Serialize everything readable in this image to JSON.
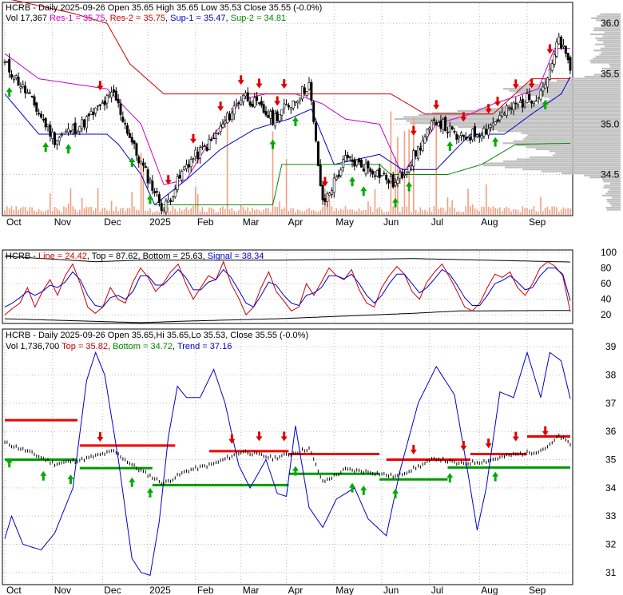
{
  "chart_data": [
    {
      "type": "candlestick",
      "header": {
        "line1": [
          "HCRB - Daily 2025-09-26 Open 35.65  High 35.65  Low 35.53  Close 35.55 (-0.0%)"
        ],
        "line2": [
          {
            "text": "Vol 17,367 ",
            "color": "#000000"
          },
          {
            "text": "Res-1 = 35.75",
            "color": "#cc00cc"
          },
          {
            "text": ", ",
            "color": "#000000"
          },
          {
            "text": "Res-2 = 35.75",
            "color": "#cc0000"
          },
          {
            "text": ", ",
            "color": "#000000"
          },
          {
            "text": "Sup-1 = 35.47",
            "color": "#0000cc"
          },
          {
            "text": ", ",
            "color": "#000000"
          },
          {
            "text": "Sup-2 = 34.81",
            "color": "#008800"
          }
        ]
      },
      "ylim": [
        34.1,
        36.2
      ],
      "yticks": [
        "36.0",
        "35.5",
        "35.0",
        "34.5"
      ],
      "months": [
        "Oct",
        "Nov",
        "Dec",
        "2025",
        "Feb",
        "Mar",
        "Apr",
        "May",
        "Jun",
        "Jul",
        "Aug",
        "Sep"
      ],
      "close_key": [
        [
          0,
          35.6
        ],
        [
          10,
          35.3
        ],
        [
          22,
          34.85
        ],
        [
          34,
          35.0
        ],
        [
          48,
          35.3
        ],
        [
          58,
          34.7
        ],
        [
          70,
          34.15
        ],
        [
          80,
          34.6
        ],
        [
          92,
          34.85
        ],
        [
          105,
          35.3
        ],
        [
          118,
          35.05
        ],
        [
          128,
          35.25
        ],
        [
          134,
          35.4
        ],
        [
          140,
          34.2
        ],
        [
          150,
          34.65
        ],
        [
          162,
          34.55
        ],
        [
          172,
          34.4
        ],
        [
          182,
          34.75
        ],
        [
          190,
          35.05
        ],
        [
          200,
          34.85
        ],
        [
          212,
          34.95
        ],
        [
          222,
          35.15
        ],
        [
          235,
          35.3
        ],
        [
          240,
          35.5
        ],
        [
          244,
          35.85
        ],
        [
          249,
          35.55
        ]
      ],
      "res1_key": [
        [
          0,
          35.7
        ],
        [
          15,
          35.45
        ],
        [
          45,
          35.35
        ],
        [
          60,
          35.0
        ],
        [
          70,
          34.4
        ],
        [
          80,
          34.45
        ],
        [
          92,
          34.9
        ],
        [
          105,
          35.25
        ],
        [
          115,
          35.3
        ],
        [
          128,
          35.3
        ],
        [
          140,
          35.2
        ],
        [
          150,
          35.05
        ],
        [
          165,
          35.0
        ],
        [
          175,
          34.5
        ],
        [
          190,
          35.0
        ],
        [
          205,
          35.1
        ],
        [
          215,
          35.2
        ],
        [
          235,
          35.35
        ],
        [
          242,
          35.75
        ],
        [
          249,
          35.75
        ]
      ],
      "res2_key": [
        [
          0,
          36.25
        ],
        [
          30,
          36.1
        ],
        [
          45,
          36.0
        ],
        [
          55,
          35.6
        ],
        [
          70,
          35.3
        ],
        [
          100,
          35.3
        ],
        [
          170,
          35.3
        ],
        [
          185,
          35.1
        ],
        [
          200,
          35.1
        ],
        [
          215,
          35.1
        ],
        [
          232,
          35.45
        ],
        [
          249,
          35.45
        ]
      ],
      "sup1_key": [
        [
          0,
          35.3
        ],
        [
          15,
          34.9
        ],
        [
          45,
          34.9
        ],
        [
          50,
          34.8
        ],
        [
          60,
          34.5
        ],
        [
          66,
          34.2
        ],
        [
          80,
          34.45
        ],
        [
          95,
          34.75
        ],
        [
          110,
          34.95
        ],
        [
          125,
          35.05
        ],
        [
          135,
          35.15
        ],
        [
          145,
          34.6
        ],
        [
          165,
          34.7
        ],
        [
          175,
          34.55
        ],
        [
          190,
          34.55
        ],
        [
          205,
          34.9
        ],
        [
          220,
          34.9
        ],
        [
          232,
          35.1
        ],
        [
          245,
          35.3
        ],
        [
          249,
          35.47
        ]
      ],
      "sup2_key": [
        [
          66,
          34.2
        ],
        [
          118,
          34.2
        ],
        [
          122,
          34.6
        ],
        [
          165,
          34.6
        ],
        [
          170,
          34.5
        ],
        [
          195,
          34.5
        ],
        [
          210,
          34.6
        ],
        [
          225,
          34.8
        ],
        [
          249,
          34.81
        ]
      ],
      "down_arrows": [
        42,
        72,
        83,
        95,
        104,
        112,
        120,
        123,
        141,
        180,
        190,
        202,
        213,
        217,
        225,
        232,
        240
      ],
      "up_arrows": [
        2,
        18,
        28,
        56,
        64,
        118,
        128,
        153,
        158,
        172,
        178,
        196,
        216,
        238
      ]
    },
    {
      "type": "line",
      "header": [
        {
          "text": "HCRB - ",
          "color": "#000000"
        },
        {
          "text": "Line = 24.42",
          "color": "#cc0000"
        },
        {
          "text": ", Top = 87.62, Bottom = 25.63, ",
          "color": "#000000"
        },
        {
          "text": "Signal = 38.34",
          "color": "#0000cc"
        }
      ],
      "ylim": [
        10,
        102
      ],
      "yticks": [
        "100",
        "80",
        "60",
        "40",
        "20"
      ],
      "months": [
        "Oct",
        "Nov",
        "Dec",
        "2025",
        "Feb",
        "Mar",
        "Apr",
        "May",
        "Jun",
        "Jul",
        "Aug",
        "Sep"
      ],
      "series": [
        {
          "name": "Line",
          "values": [
            20,
            28,
            35,
            55,
            30,
            50,
            65,
            45,
            70,
            85,
            60,
            30,
            22,
            30,
            55,
            40,
            35,
            62,
            80,
            68,
            50,
            60,
            75,
            85,
            60,
            40,
            55,
            70,
            65,
            88,
            60,
            42,
            20,
            30,
            55,
            75,
            50,
            38,
            25,
            30,
            60,
            45,
            62,
            80,
            70,
            65,
            78,
            52,
            35,
            30,
            55,
            70,
            82,
            72,
            50,
            40,
            62,
            75,
            85,
            68,
            50,
            30,
            25,
            35,
            55,
            72,
            68,
            75,
            55,
            45,
            60,
            80,
            88,
            82,
            70,
            24
          ]
        },
        {
          "name": "Signal",
          "values": [
            30,
            35,
            42,
            50,
            45,
            50,
            58,
            55,
            62,
            75,
            65,
            45,
            32,
            30,
            42,
            45,
            40,
            50,
            70,
            70,
            58,
            58,
            68,
            78,
            68,
            52,
            52,
            62,
            65,
            78,
            68,
            52,
            35,
            30,
            45,
            62,
            58,
            45,
            35,
            32,
            45,
            48,
            55,
            70,
            70,
            66,
            72,
            60,
            45,
            35,
            45,
            60,
            72,
            72,
            60,
            48,
            55,
            66,
            78,
            72,
            58,
            42,
            32,
            32,
            45,
            60,
            64,
            70,
            62,
            52,
            55,
            70,
            80,
            80,
            72,
            38
          ]
        }
      ],
      "top_key": [
        [
          0,
          95
        ],
        [
          40,
          88
        ],
        [
          60,
          90
        ],
        [
          120,
          90
        ],
        [
          180,
          92
        ],
        [
          249,
          87.62
        ]
      ],
      "bottom_key": [
        [
          0,
          15
        ],
        [
          60,
          10
        ],
        [
          80,
          12
        ],
        [
          120,
          15
        ],
        [
          180,
          22
        ],
        [
          200,
          25
        ],
        [
          249,
          25.63
        ]
      ]
    },
    {
      "type": "line",
      "header": {
        "line1": [
          "HCRB - Daily 2025-09-26 Open 35.65,Hi 35.65,Lo 35.53, Close 35.55 (-0.0%)"
        ],
        "line2": [
          {
            "text": "Vol 1,736,700 ",
            "color": "#000000"
          },
          {
            "text": "Top = 35.82",
            "color": "#cc0000"
          },
          {
            "text": ", ",
            "color": "#000000"
          },
          {
            "text": "Bottom = 34.72",
            "color": "#008800"
          },
          {
            "text": ", ",
            "color": "#000000"
          },
          {
            "text": "Trend = 37.16",
            "color": "#0000cc"
          }
        ]
      },
      "ylim": [
        30.6,
        39.6
      ],
      "yticks": [
        "39",
        "38",
        "37",
        "36",
        "35",
        "34",
        "33",
        "32",
        "31"
      ],
      "months": [
        "Oct",
        "Nov",
        "Dec",
        "2025",
        "Feb",
        "Mar",
        "Apr",
        "May",
        "Jun",
        "Jul",
        "Aug",
        "Sep"
      ],
      "trend_key": [
        [
          0,
          32.2
        ],
        [
          3,
          33.0
        ],
        [
          8,
          32.0
        ],
        [
          16,
          31.8
        ],
        [
          22,
          32.4
        ],
        [
          30,
          34.0
        ],
        [
          36,
          37.8
        ],
        [
          40,
          38.8
        ],
        [
          44,
          38.0
        ],
        [
          50,
          35.0
        ],
        [
          56,
          31.5
        ],
        [
          60,
          31.0
        ],
        [
          64,
          30.9
        ],
        [
          68,
          32.8
        ],
        [
          72,
          35.8
        ],
        [
          76,
          37.6
        ],
        [
          80,
          37.2
        ],
        [
          86,
          37.2
        ],
        [
          92,
          38.2
        ],
        [
          97,
          37.0
        ],
        [
          103,
          34.8
        ],
        [
          108,
          34.0
        ],
        [
          115,
          35.0
        ],
        [
          120,
          33.8
        ],
        [
          124,
          33.7
        ],
        [
          128,
          36.2
        ],
        [
          134,
          33.3
        ],
        [
          140,
          32.6
        ],
        [
          146,
          33.6
        ],
        [
          154,
          34.0
        ],
        [
          160,
          32.9
        ],
        [
          168,
          32.3
        ],
        [
          174,
          34.6
        ],
        [
          182,
          37.0
        ],
        [
          190,
          38.3
        ],
        [
          198,
          37.3
        ],
        [
          204,
          34.5
        ],
        [
          208,
          32.5
        ],
        [
          212,
          34.0
        ],
        [
          218,
          37.4
        ],
        [
          224,
          37.2
        ],
        [
          230,
          38.8
        ],
        [
          236,
          37.2
        ],
        [
          240,
          38.8
        ],
        [
          245,
          38.5
        ],
        [
          249,
          37.16
        ]
      ],
      "top_levels": [
        [
          0,
          32,
          36.4
        ],
        [
          33,
          75,
          35.5
        ],
        [
          90,
          125,
          35.3
        ],
        [
          125,
          165,
          35.2
        ],
        [
          168,
          205,
          35.0
        ],
        [
          205,
          230,
          35.2
        ],
        [
          230,
          249,
          35.82
        ]
      ],
      "bottom_levels": [
        [
          0,
          32,
          35.0
        ],
        [
          33,
          65,
          34.7
        ],
        [
          65,
          125,
          34.1
        ],
        [
          125,
          165,
          34.5
        ],
        [
          165,
          195,
          34.3
        ],
        [
          195,
          249,
          34.72
        ]
      ],
      "down_arrows": [
        42,
        100,
        112,
        123,
        180,
        202,
        213,
        225,
        238
      ],
      "up_arrows": [
        2,
        17,
        29,
        56,
        64,
        128,
        153,
        158,
        172,
        196,
        216
      ]
    }
  ]
}
